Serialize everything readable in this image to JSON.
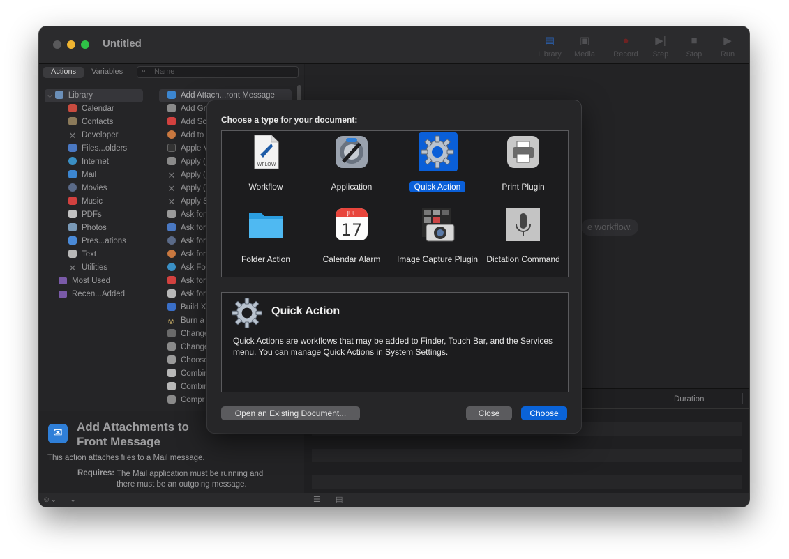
{
  "window": {
    "title": "Untitled",
    "toolbar": [
      {
        "label": "Library",
        "icon": "library-icon"
      },
      {
        "label": "Media",
        "icon": "media-icon"
      },
      {
        "label": "Record",
        "icon": "record-icon"
      },
      {
        "label": "Step",
        "icon": "step-icon"
      },
      {
        "label": "Stop",
        "icon": "stop-icon"
      },
      {
        "label": "Run",
        "icon": "run-icon"
      }
    ]
  },
  "left_pane": {
    "tabs": [
      "Actions",
      "Variables"
    ],
    "search_placeholder": "Name",
    "library": [
      {
        "label": "Library",
        "color": "#6b8fb8"
      },
      {
        "label": "Calendar",
        "color": "#c84b3f"
      },
      {
        "label": "Contacts",
        "color": "#8b7a5a"
      },
      {
        "label": "Developer",
        "color": "x"
      },
      {
        "label": "Files...olders",
        "color": "#4a78c2"
      },
      {
        "label": "Internet",
        "color": "#3a8fc4"
      },
      {
        "label": "Mail",
        "color": "#3c86d0"
      },
      {
        "label": "Movies",
        "color": "#5a6a88"
      },
      {
        "label": "Music",
        "color": "#d2413f"
      },
      {
        "label": "PDFs",
        "color": "#c2c2c2"
      },
      {
        "label": "Photos",
        "color": "#7a9ab8"
      },
      {
        "label": "Pres...ations",
        "color": "#4a8ad8"
      },
      {
        "label": "Text",
        "color": "#b8b8b8"
      },
      {
        "label": "Utilities",
        "color": "x"
      },
      {
        "label": "Most Used",
        "color": "folder"
      },
      {
        "label": "Recen...Added",
        "color": "folder"
      }
    ],
    "actions": [
      "Add Attach...ront Message",
      "Add Gr",
      "Add Sc",
      "Add to",
      "Apple V",
      "Apply (",
      "Apply (",
      "Apply (",
      "Apply S",
      "Ask for",
      "Ask for",
      "Ask for",
      "Ask for",
      "Ask Fo",
      "Ask for",
      "Ask for",
      "Build X",
      "Burn a",
      "Change",
      "Change",
      "Choose",
      "Combir",
      "Combir",
      "Compr"
    ]
  },
  "description": {
    "title": "Add Attachments to Front Message",
    "text": "This action attaches files to a Mail message.",
    "requires_label": "Requires:",
    "requires_text": "The Mail application must be running and there must be an outgoing message."
  },
  "workflow": {
    "hint": "e workflow."
  },
  "log": {
    "columns": [
      "Duration"
    ]
  },
  "dialog": {
    "prompt": "Choose a type for your document:",
    "types": [
      {
        "label": "Workflow",
        "icon": "workflow-icon"
      },
      {
        "label": "Application",
        "icon": "application-icon"
      },
      {
        "label": "Quick Action",
        "icon": "gear-icon",
        "selected": true
      },
      {
        "label": "Print Plugin",
        "icon": "printer-icon"
      },
      {
        "label": "Folder Action",
        "icon": "folder-icon"
      },
      {
        "label": "Calendar Alarm",
        "icon": "calendar-icon"
      },
      {
        "label": "Image Capture Plugin",
        "icon": "camera-icon"
      },
      {
        "label": "Dictation Command",
        "icon": "microphone-icon"
      }
    ],
    "workflow_icon_text": "WFLOW",
    "calendar_month": "JUL",
    "calendar_day": "17",
    "info_title": "Quick Action",
    "info_text": "Quick Actions are workflows that may be added to Finder, Touch Bar, and the Services menu. You can manage Quick Actions in System Settings.",
    "buttons": {
      "open_existing": "Open an Existing Document...",
      "close": "Close",
      "choose": "Choose"
    }
  },
  "colors": {
    "accent": "#0a63d8",
    "window_bg": "#1f1f21"
  }
}
